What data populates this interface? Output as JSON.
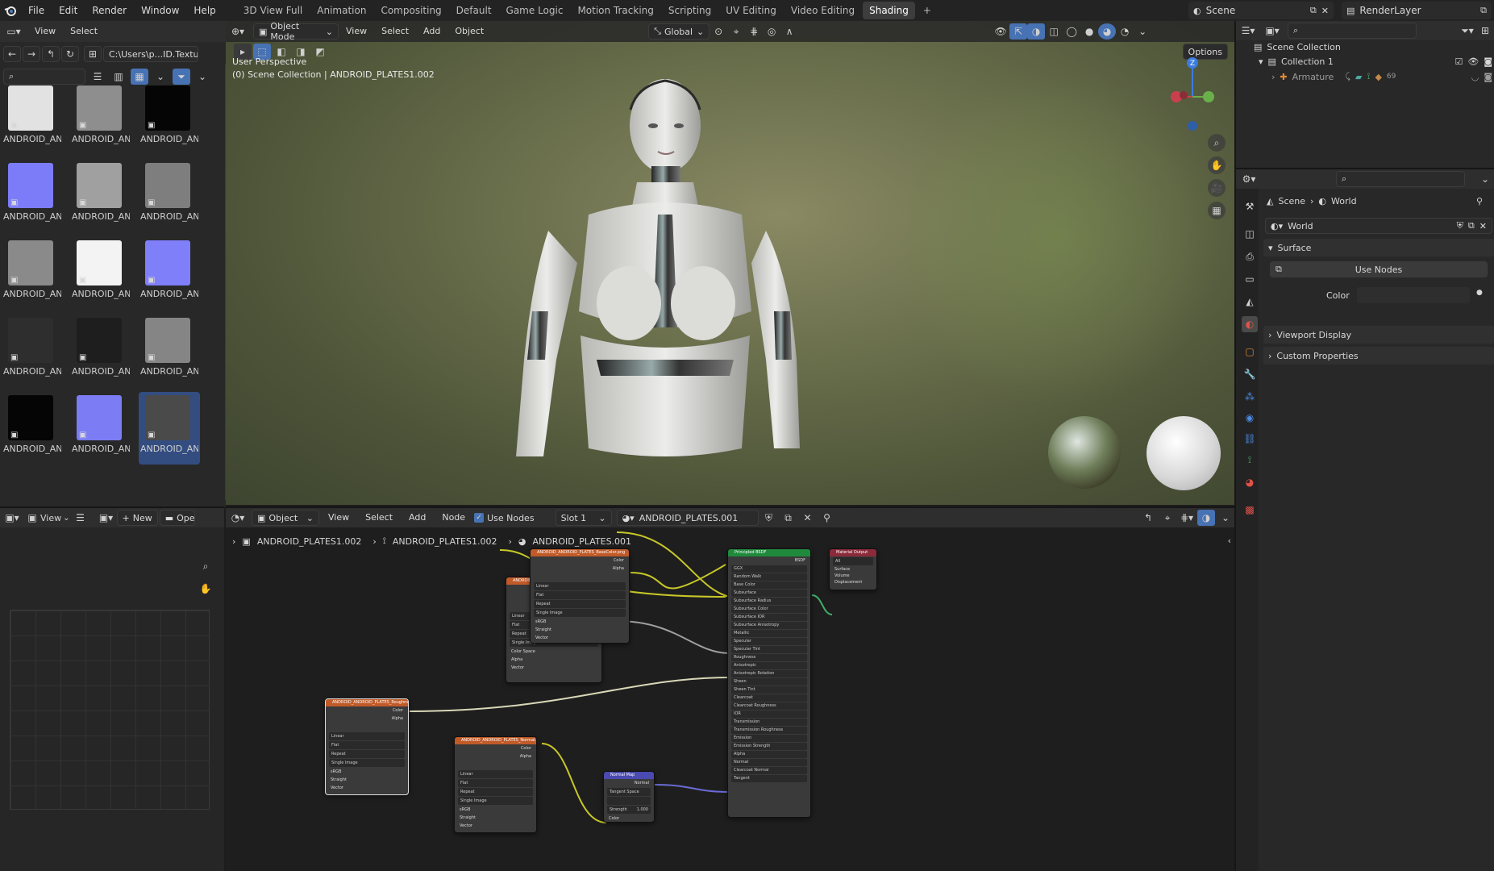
{
  "topbar": {
    "menus": [
      "File",
      "Edit",
      "Render",
      "Window",
      "Help"
    ],
    "workspaces": [
      "3D View Full",
      "Animation",
      "Compositing",
      "Default",
      "Game Logic",
      "Motion Tracking",
      "Scripting",
      "UV Editing",
      "Video Editing",
      "Shading"
    ],
    "active_workspace": "Shading",
    "add_workspace": "+",
    "scene": "Scene",
    "render_layer": "RenderLayer"
  },
  "file_browser": {
    "menus": [
      "View",
      "Select"
    ],
    "path": "C:\\Users\\p...ID.Texture\\",
    "thumbnails": [
      {
        "label": "ANDROID_AN...",
        "color": "#e2e2e2"
      },
      {
        "label": "ANDROID_AN...",
        "color": "#8e8e8e"
      },
      {
        "label": "ANDROID_AN...",
        "color": "#050505"
      },
      {
        "label": "ANDROID_AN...",
        "color": "#7c7cf8"
      },
      {
        "label": "ANDROID_AN...",
        "color": "#a0a0a0"
      },
      {
        "label": "ANDROID_AN...",
        "color": "#7e7e7e"
      },
      {
        "label": "ANDROID_AN...",
        "color": "#8a8a8a"
      },
      {
        "label": "ANDROID_AN...",
        "color": "#f3f3f3"
      },
      {
        "label": "ANDROID_AN...",
        "color": "#7f7ff9"
      },
      {
        "label": "ANDROID_AN...",
        "color": "#2e2e2e"
      },
      {
        "label": "ANDROID_AN...",
        "color": "#1e1e1e"
      },
      {
        "label": "ANDROID_AN...",
        "color": "#858585"
      },
      {
        "label": "ANDROID_AN...",
        "color": "#050505"
      },
      {
        "label": "ANDROID_AN...",
        "color": "#7c7cf5"
      },
      {
        "label": "ANDROID_AN...",
        "color": "#4a4a4a"
      }
    ]
  },
  "viewport": {
    "mode": "Object Mode",
    "menus": [
      "View",
      "Select",
      "Add",
      "Object"
    ],
    "transform": "Global",
    "options": "Options",
    "overlay_line1": "User Perspective",
    "overlay_line2": "(0) Scene Collection | ANDROID_PLATES1.002",
    "gizmo_z": "Z"
  },
  "outliner": {
    "scene_collection": "Scene Collection",
    "collection": "Collection 1",
    "armature": "Armature",
    "armature_count": "69"
  },
  "properties": {
    "breadcrumb_scene": "Scene",
    "breadcrumb_world": "World",
    "world_name": "World",
    "surface_label": "Surface",
    "use_nodes": "Use Nodes",
    "color_label": "Color",
    "viewport_display": "Viewport Display",
    "custom_properties": "Custom Properties"
  },
  "image_editor": {
    "view": "View",
    "new": "New",
    "open": "Open"
  },
  "node_editor": {
    "object": "Object",
    "menus": [
      "View",
      "Select",
      "Add",
      "Node"
    ],
    "use_nodes": "Use Nodes",
    "slot": "Slot 1",
    "material": "ANDROID_PLATES.001",
    "breadcrumb": [
      "ANDROID_PLATES1.002",
      "ANDROID_PLATES1.002",
      "ANDROID_PLATES.001"
    ],
    "nodes": {
      "metallic": "ANDROID_ANDROID_PLATES_Metallic.png",
      "basecolor": "ANDROID_ANDROID_PLATES_BaseColor.png",
      "roughness": "ANDROID_ANDROID_PLATES_Roughness.png",
      "normal": "ANDROID_ANDROID_PLATES_Normal.png",
      "normalmap": "Normal Map",
      "bsdf": "Principled BSDF",
      "output": "Material Output"
    },
    "image_rows": [
      "Linear",
      "Flat",
      "Repeat",
      "Single Image"
    ],
    "color_space_label": "Color Space",
    "color_space": "sRGB",
    "alpha_label": "Alpha",
    "alpha_value": "Straight",
    "vector": "Vector",
    "color": "Color",
    "alpha": "Alpha",
    "tangent_space": "Tangent Space",
    "strength_label": "Strength",
    "strength_value": "1.000",
    "normal": "Normal",
    "bsdf_out": "BSDF",
    "bsdf_rows": [
      "GGX",
      "Random Walk",
      "Base Color",
      "Subsurface",
      "Subsurface Radius",
      "Subsurface Color",
      "Subsurface IOR",
      "Subsurface Anisotropy",
      "Metallic",
      "Specular",
      "Specular Tint",
      "Roughness",
      "Anisotropic",
      "Anisotropic Rotation",
      "Sheen",
      "Sheen Tint",
      "Clearcoat",
      "Clearcoat Roughness",
      "IOR",
      "Transmission",
      "Transmission Roughness",
      "Emission",
      "Emission Strength",
      "Alpha",
      "Normal",
      "Clearcoat Normal",
      "Tangent"
    ],
    "output_rows": [
      "All",
      "Surface",
      "Volume",
      "Displacement"
    ]
  }
}
